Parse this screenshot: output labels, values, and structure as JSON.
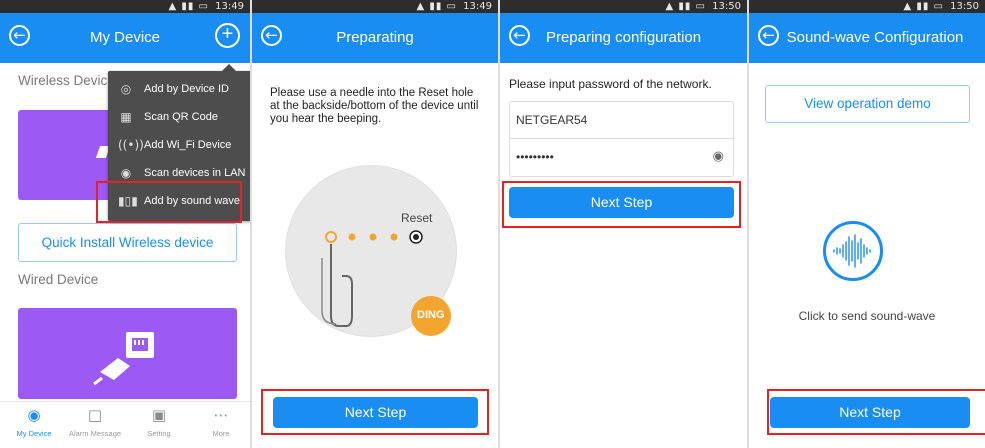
{
  "status": {
    "time1": "13:49",
    "time2": "13:49",
    "time3": "13:50",
    "time4": "13:50",
    "icons": "wifi signal battery"
  },
  "screen1": {
    "title": "My Device",
    "wireless_label": "Wireless Devic",
    "wired_label": "Wired Device",
    "quick_install": "Quick Install Wireless device",
    "menu": [
      {
        "label": "Add by Device ID",
        "icon": "device-id-icon"
      },
      {
        "label": "Scan QR Code",
        "icon": "qr-code-icon"
      },
      {
        "label": "Add Wi_Fi Device",
        "icon": "wifi-icon"
      },
      {
        "label": "Scan devices in LAN",
        "icon": "lan-scan-icon"
      },
      {
        "label": "Add by sound wave",
        "icon": "sound-wave-icon"
      }
    ],
    "tabs": [
      {
        "label": "My Device",
        "icon": "camera-icon"
      },
      {
        "label": "Alarm Message",
        "icon": "message-icon"
      },
      {
        "label": "Setting",
        "icon": "monitor-icon"
      },
      {
        "label": "More",
        "icon": "more-icon"
      }
    ]
  },
  "screen2": {
    "title": "Preparating",
    "instruction": "Please use a needle into the Reset hole at the backside/bottom of the device until you hear the beeping.",
    "reset_label": "Reset",
    "ding_label": "DING",
    "next_label": "Next Step"
  },
  "screen3": {
    "title": "Preparing configuration",
    "prompt": "Please input password of the network.",
    "ssid": "NETGEAR54",
    "password_mask": "•••••••••",
    "next_label": "Next Step"
  },
  "screen4": {
    "title": "Sound-wave Configuration",
    "demo_label": "View operation demo",
    "send_label": "Click to send sound-wave",
    "next_label": "Next Step"
  },
  "colors": {
    "accent": "#1a8df2",
    "purple": "#9d59f4",
    "highlight": "#e32424",
    "orange": "#f4a530"
  }
}
